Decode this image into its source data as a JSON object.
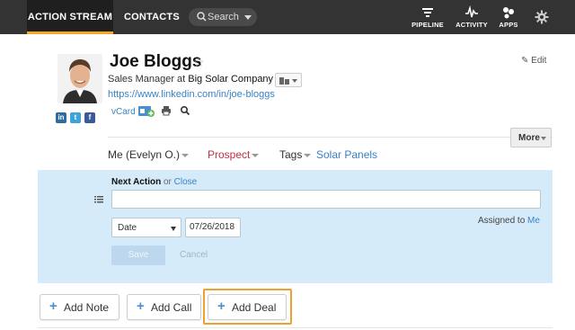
{
  "nav": {
    "tabs": [
      {
        "label": "ACTION STREAM",
        "active": true
      },
      {
        "label": "CONTACTS",
        "active": false
      }
    ],
    "search_label": "Search",
    "right": [
      {
        "label": "PIPELINE",
        "icon": "filter-icon"
      },
      {
        "label": "ACTIVITY",
        "icon": "pulse-icon"
      },
      {
        "label": "APPS",
        "icon": "apps-icon"
      }
    ]
  },
  "contact": {
    "name": "Joe Bloggs",
    "title_prefix": "Sales Manager at",
    "company": "Big Solar Company",
    "linkedin_url": "https://www.linkedin.com/in/joe-bloggs",
    "vcard": "vCard",
    "edit": "Edit"
  },
  "more_label": "More",
  "meta": {
    "owner": "Me (Evelyn O.)",
    "stage": "Prospect",
    "tags_label": "Tags",
    "tag": "Solar Panels"
  },
  "next_action": {
    "title": "Next Action",
    "or": "or",
    "close": "Close",
    "input_value": "",
    "date_type": "Date",
    "date_value": "07/26/2018",
    "assigned_prefix": "Assigned to",
    "assigned_to": "Me",
    "save": "Save",
    "cancel": "Cancel"
  },
  "add_buttons": [
    "Add Note",
    "Add Call",
    "Add Deal"
  ],
  "colors": {
    "nav_bg": "#333333",
    "nav_accent": "#f5a623",
    "link": "#3a82c4",
    "stage": "#c0304a",
    "panel_bg": "#d6ebfa",
    "highlight": "#f0a030"
  }
}
